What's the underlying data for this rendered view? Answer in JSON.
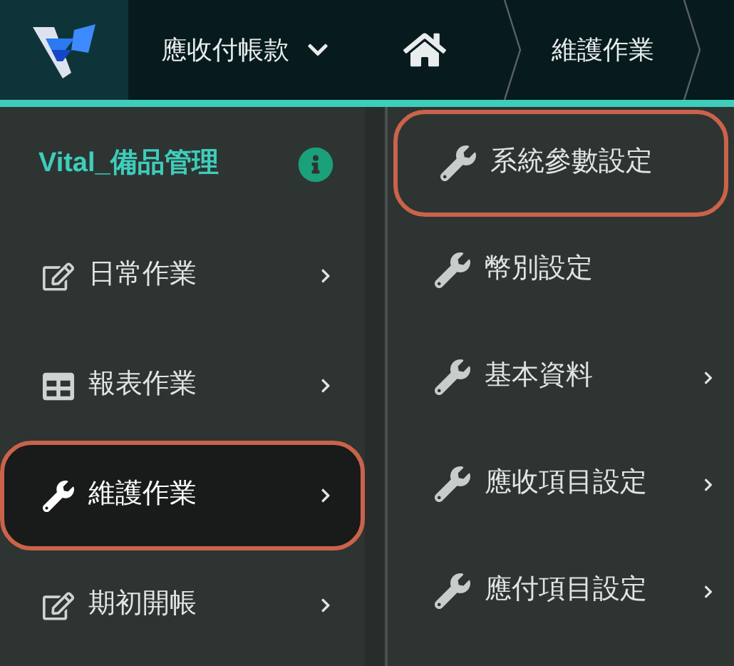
{
  "header": {
    "module": "應收付帳款",
    "breadcrumb": [
      "維護作業"
    ]
  },
  "sidebar": {
    "title": "Vital_備品管理",
    "items": [
      {
        "label": "日常作業",
        "kind": "edit",
        "selected": false,
        "circled": false,
        "has_submenu": true
      },
      {
        "label": "報表作業",
        "kind": "table",
        "selected": false,
        "circled": false,
        "has_submenu": true
      },
      {
        "label": "維護作業",
        "kind": "wrench",
        "selected": true,
        "circled": true,
        "has_submenu": true
      },
      {
        "label": "期初開帳",
        "kind": "edit",
        "selected": false,
        "circled": false,
        "has_submenu": true
      }
    ]
  },
  "submenu": {
    "items": [
      {
        "label": "系統參數設定",
        "kind": "wrench",
        "circled": true,
        "has_submenu": false
      },
      {
        "label": "幣別設定",
        "kind": "wrench",
        "circled": false,
        "has_submenu": false
      },
      {
        "label": "基本資料",
        "kind": "wrench",
        "circled": false,
        "has_submenu": true
      },
      {
        "label": "應收項目設定",
        "kind": "wrench",
        "circled": false,
        "has_submenu": true
      },
      {
        "label": "應付項目設定",
        "kind": "wrench",
        "circled": false,
        "has_submenu": true
      }
    ]
  }
}
